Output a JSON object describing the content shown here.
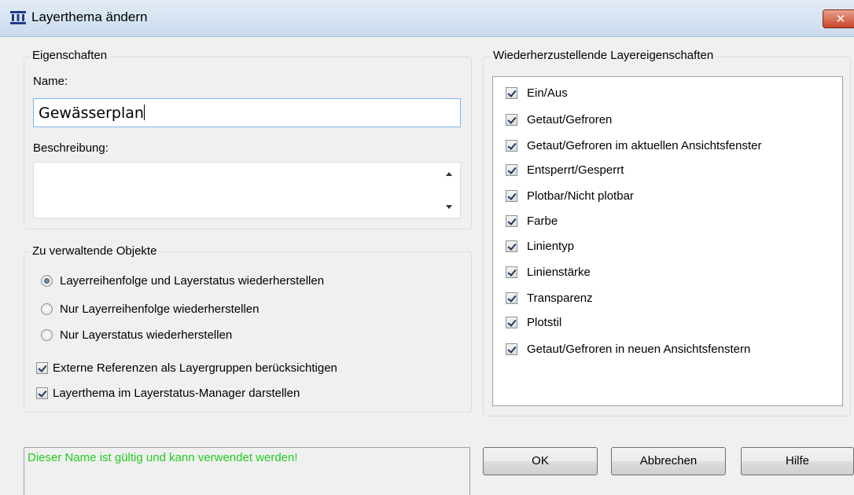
{
  "window": {
    "title": "Layerthema ändern",
    "close_label": "✕"
  },
  "properties": {
    "legend": "Eigenschaften",
    "name_label": "Name:",
    "name_value": "Gewässerplan",
    "description_label": "Beschreibung:",
    "description_value": ""
  },
  "objects": {
    "legend": "Zu verwaltende Objekte",
    "radios": [
      {
        "label": "Layerreihenfolge und Layerstatus wiederherstellen",
        "selected": true
      },
      {
        "label": "Nur Layerreihenfolge wiederherstellen",
        "selected": false
      },
      {
        "label": "Nur Layerstatus wiederherstellen",
        "selected": false
      }
    ],
    "checkboxes": [
      {
        "label": "Externe Referenzen als Layergruppen berücksichtigen",
        "checked": true
      },
      {
        "label": "Layerthema im Layerstatus-Manager darstellen",
        "checked": true
      }
    ]
  },
  "restore": {
    "legend": "Wiederherzustellende Layereigenschaften",
    "items": [
      {
        "label": "Ein/Aus",
        "checked": true
      },
      {
        "label": "Getaut/Gefroren",
        "checked": true
      },
      {
        "label": "Getaut/Gefroren im aktuellen Ansichtsfenster",
        "checked": true
      },
      {
        "label": "Entsperrt/Gesperrt",
        "checked": true
      },
      {
        "label": "Plotbar/Nicht plotbar",
        "checked": true
      },
      {
        "label": "Farbe",
        "checked": true
      },
      {
        "label": "Linientyp",
        "checked": true
      },
      {
        "label": "Linienstärke",
        "checked": true
      },
      {
        "label": "Transparenz",
        "checked": true
      },
      {
        "label": "Plotstil",
        "checked": true
      },
      {
        "label": "Getaut/Gefroren in neuen Ansichtsfenstern",
        "checked": true
      }
    ]
  },
  "status": {
    "message": "Dieser Name ist gültig und kann verwendet werden!",
    "color": "#22cc22"
  },
  "buttons": {
    "ok": "OK",
    "cancel": "Abbrechen",
    "help": "Hilfe"
  }
}
